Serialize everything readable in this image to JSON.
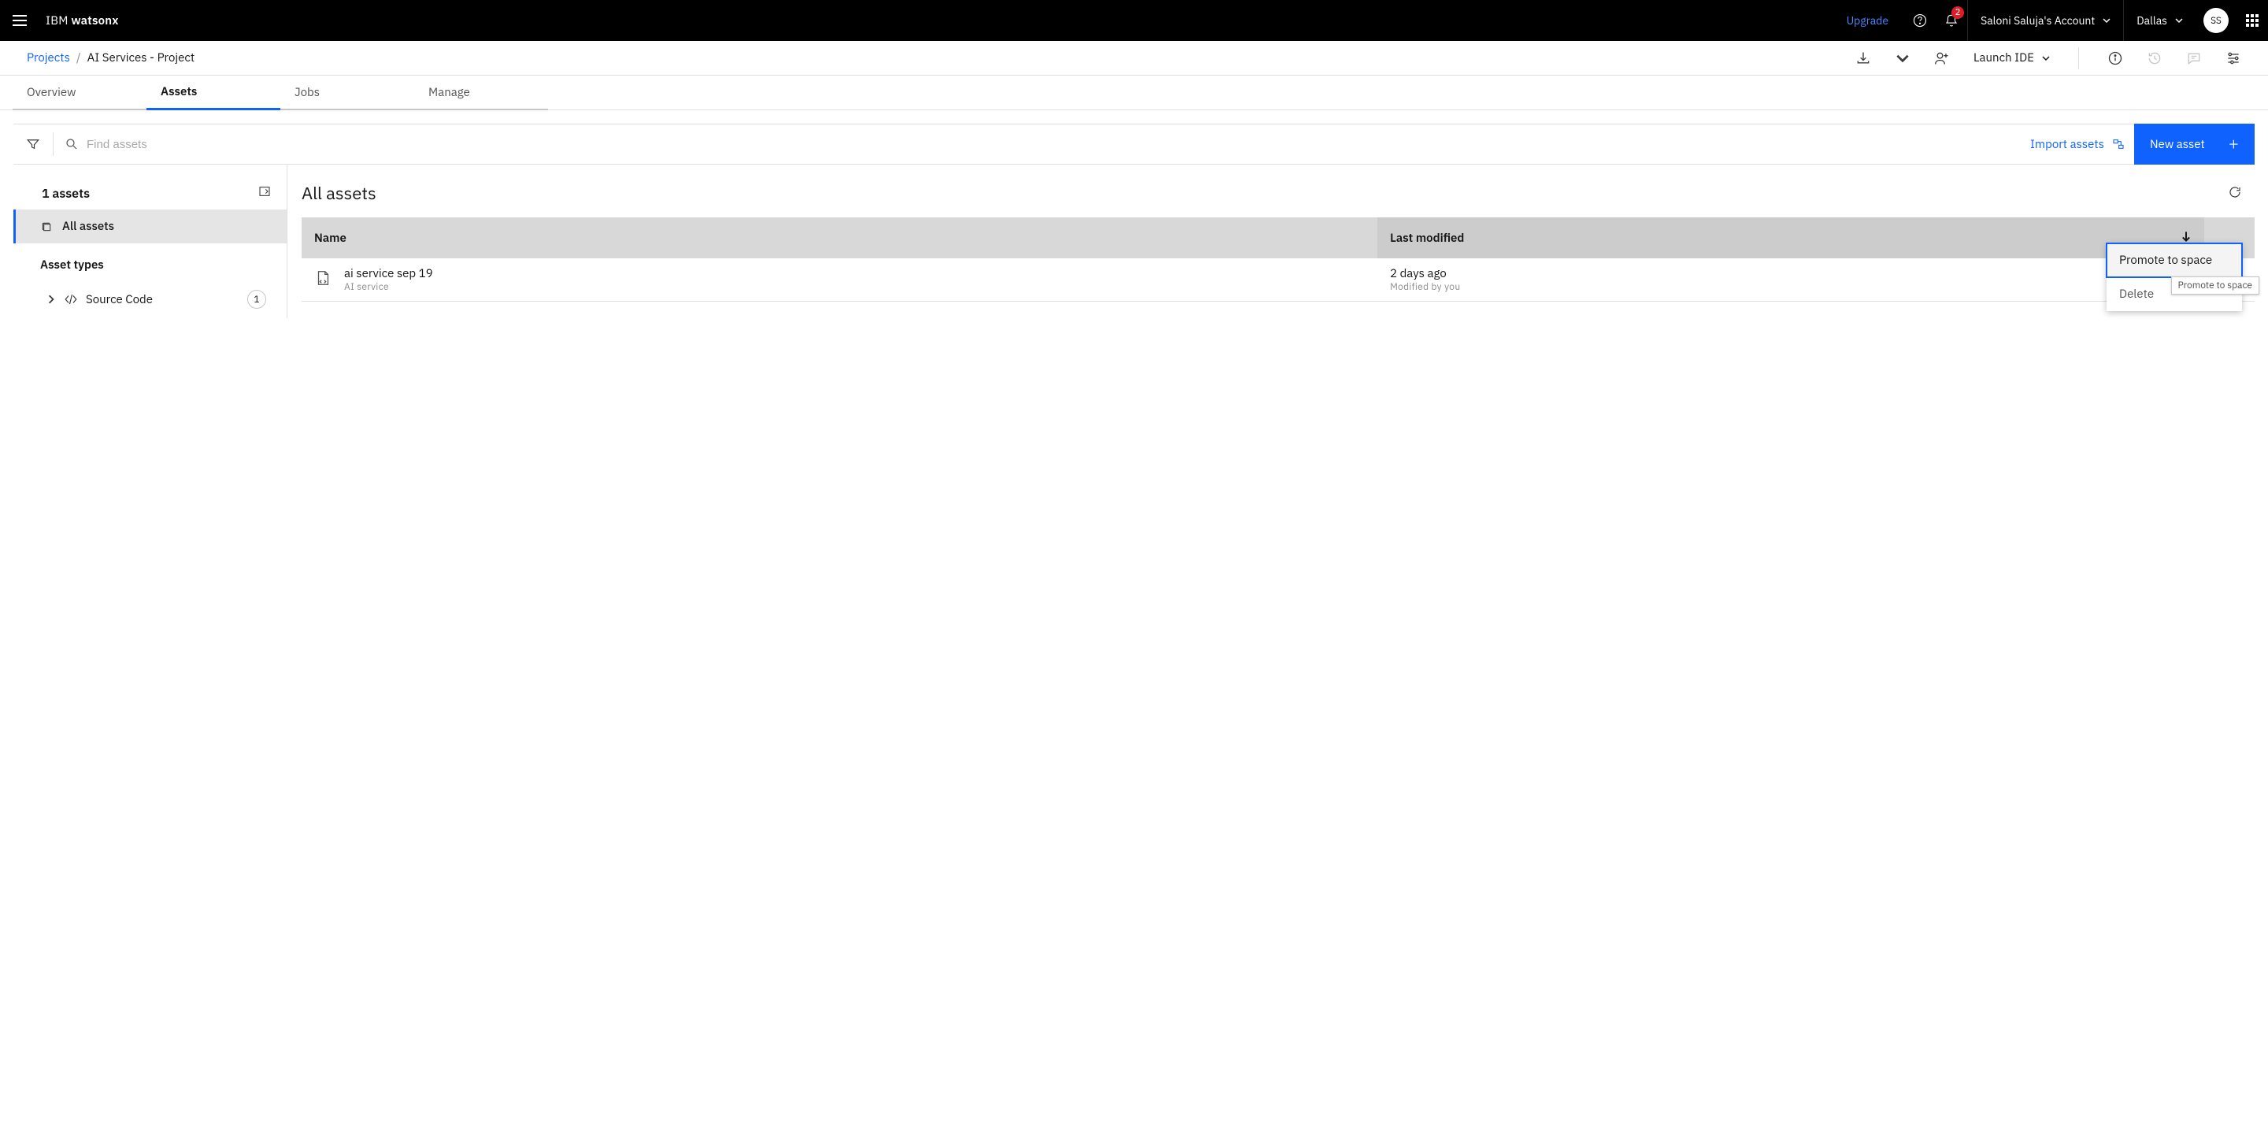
{
  "header": {
    "brand_prefix": "IBM ",
    "brand_strong": "watsonx",
    "upgrade": "Upgrade",
    "notification_count": "2",
    "account": "Saloni Saluja's Account",
    "region": "Dallas",
    "avatar": "SS"
  },
  "breadcrumb": {
    "root": "Projects",
    "sep": "/",
    "current": "AI Services - Project"
  },
  "subactions": {
    "launch_ide": "Launch IDE"
  },
  "tabs": {
    "items": [
      {
        "label": "Overview"
      },
      {
        "label": "Assets"
      },
      {
        "label": "Jobs"
      },
      {
        "label": "Manage"
      }
    ]
  },
  "toolbar": {
    "search_placeholder": "Find assets",
    "import": "Import assets",
    "new_asset": "New asset"
  },
  "sidebar": {
    "count_label": "1 assets",
    "all_assets": "All assets",
    "asset_types": "Asset types",
    "tree": {
      "label": "Source Code",
      "count": "1"
    }
  },
  "table": {
    "title": "All assets",
    "columns": {
      "name": "Name",
      "last_modified": "Last modified"
    },
    "rows": [
      {
        "name": "ai service sep 19",
        "subtitle": "AI service",
        "modified": "2 days ago",
        "modified_by": "Modified by you"
      }
    ]
  },
  "context_menu": {
    "promote": "Promote to space",
    "delete": "Delete",
    "tooltip": "Promote to space"
  }
}
